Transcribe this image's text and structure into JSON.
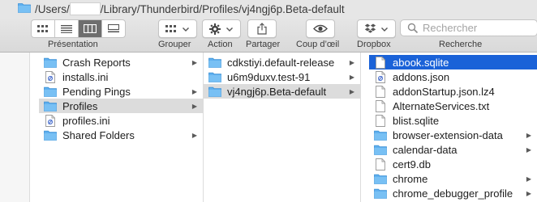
{
  "window": {
    "path_prefix": "/Users/",
    "path_suffix": "/Library/Thunderbird/Profiles/vj4ngj6p.Beta-default"
  },
  "toolbar": {
    "presentation_label": "Présentation",
    "group_label": "Grouper",
    "action_label": "Action",
    "share_label": "Partager",
    "quicklook_label": "Coup d’œil",
    "dropbox_label": "Dropbox",
    "search_label": "Recherche",
    "search_placeholder": "Rechercher"
  },
  "columns": {
    "col1": [
      {
        "label": "Crash Reports",
        "icon": "folder-icon",
        "chevron": true
      },
      {
        "label": "installs.ini",
        "icon": "document-icon",
        "chevron": false
      },
      {
        "label": "Pending Pings",
        "icon": "folder-icon",
        "chevron": true
      },
      {
        "label": "Profiles",
        "icon": "folder-icon",
        "chevron": true
      },
      {
        "label": "profiles.ini",
        "icon": "document-icon",
        "chevron": false
      },
      {
        "label": "Shared Folders",
        "icon": "folder-icon",
        "chevron": true
      }
    ],
    "col2": [
      {
        "label": "cdkstiyi.default-release",
        "icon": "folder-icon",
        "chevron": true
      },
      {
        "label": "u6m9duxv.test-91",
        "icon": "folder-icon",
        "chevron": true
      },
      {
        "label": "vj4ngj6p.Beta-default",
        "icon": "folder-icon",
        "chevron": true
      }
    ],
    "col3": [
      {
        "label": "abook.sqlite",
        "icon": "file-icon",
        "chevron": false
      },
      {
        "label": "addons.json",
        "icon": "document-icon",
        "chevron": false
      },
      {
        "label": "addonStartup.json.lz4",
        "icon": "file-icon",
        "chevron": false
      },
      {
        "label": "AlternateServices.txt",
        "icon": "file-icon",
        "chevron": false
      },
      {
        "label": "blist.sqlite",
        "icon": "file-icon",
        "chevron": false
      },
      {
        "label": "browser-extension-data",
        "icon": "folder-icon",
        "chevron": true
      },
      {
        "label": "calendar-data",
        "icon": "folder-icon",
        "chevron": true
      },
      {
        "label": "cert9.db",
        "icon": "file-icon",
        "chevron": false
      },
      {
        "label": "chrome",
        "icon": "folder-icon",
        "chevron": true
      },
      {
        "label": "chrome_debugger_profile",
        "icon": "folder-icon",
        "chevron": true
      }
    ]
  },
  "colors": {
    "selection_blue": "#1a62d8",
    "selection_grey": "#dcdcdc",
    "folder_blue": "#5fb0ef"
  }
}
